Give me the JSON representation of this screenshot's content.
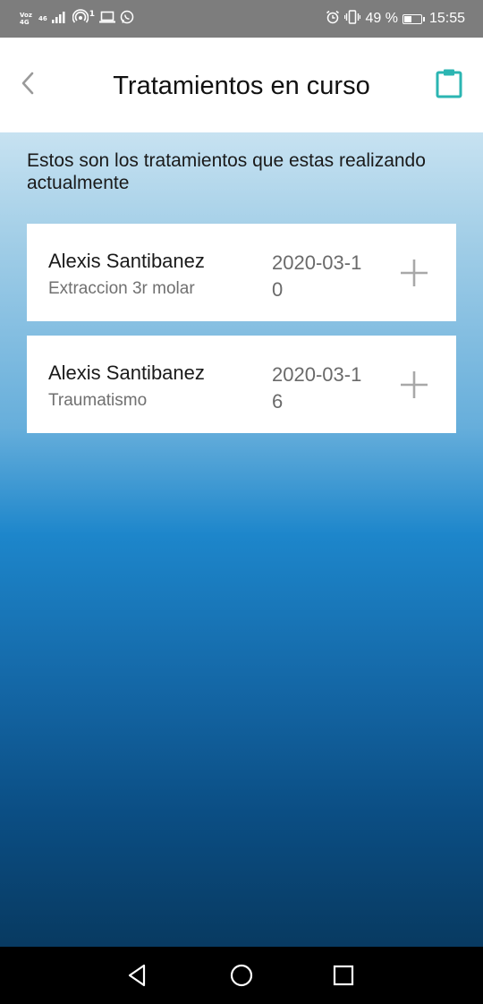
{
  "status_bar": {
    "carrier_label": "Voz 4G",
    "network_label": "46",
    "hotspot_count": "1",
    "battery_percent": "49 %",
    "battery_level": 0.49,
    "time": "15:55"
  },
  "header": {
    "title": "Tratamientos en curso",
    "accent_color": "#2bb5b2"
  },
  "intro": "Estos son los tratamientos que estas realizando actualmente",
  "treatments": [
    {
      "name": "Alexis Santibanez",
      "detail": "Extraccion 3r molar",
      "date": "2020-03-10"
    },
    {
      "name": "Alexis Santibanez",
      "detail": "Traumatismo",
      "date": "2020-03-16"
    }
  ],
  "icons": {
    "back": "chevron-left-icon",
    "clipboard": "clipboard-icon",
    "add": "plus-icon",
    "nav_back": "triangle-back-icon",
    "nav_home": "circle-home-icon",
    "nav_recents": "square-recents-icon"
  }
}
